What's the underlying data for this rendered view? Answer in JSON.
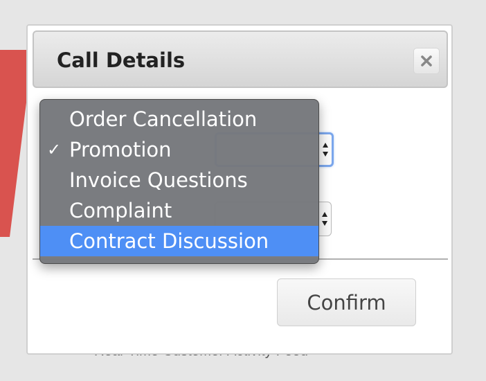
{
  "dialog": {
    "title": "Call Details",
    "close_icon": "close-x-icon",
    "confirm_label": "Confirm"
  },
  "background": {
    "footer_text": "Real-Time Customer Activity Feed"
  },
  "dropdown": {
    "checked_index": 1,
    "highlighted_index": 4,
    "options": [
      {
        "label": "Order Cancellation"
      },
      {
        "label": "Promotion"
      },
      {
        "label": "Invoice Questions"
      },
      {
        "label": "Complaint"
      },
      {
        "label": "Contract Discussion"
      }
    ]
  },
  "colors": {
    "highlight": "#4e8ff5",
    "menu_bg": "#76787c",
    "focus_ring": "#7aa6ec",
    "logo_red": "#d9534f"
  }
}
